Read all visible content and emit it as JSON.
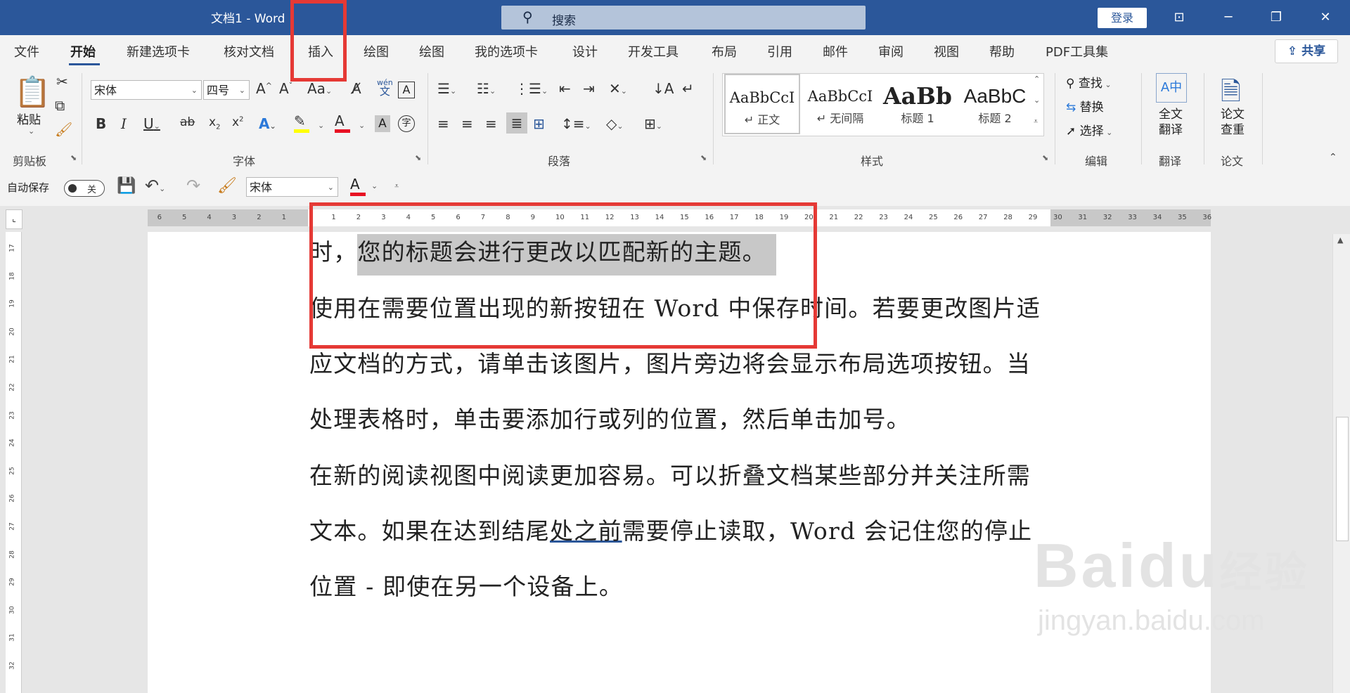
{
  "titlebar": {
    "title": "文档1  -  Word",
    "search_placeholder": "搜索",
    "login_label": "登录",
    "min_icon": "minimize-icon",
    "restore_icon": "restore-icon",
    "close_icon": "close-icon"
  },
  "tabs": [
    "文件",
    "开始",
    "新建选项卡",
    "核对文档",
    "插入",
    "绘图",
    "绘图",
    "我的选项卡",
    "设计",
    "开发工具",
    "布局",
    "引用",
    "邮件",
    "审阅",
    "视图",
    "帮助",
    "PDF工具集"
  ],
  "active_tab": "开始",
  "share_label": "共享",
  "ribbon": {
    "clipboard": {
      "paste_label": "粘贴",
      "group_label": "剪贴板"
    },
    "font": {
      "font_name": "宋体",
      "font_size": "四号",
      "group_label": "字体",
      "wen_label": "wén",
      "wen_char": "文"
    },
    "paragraph": {
      "group_label": "段落"
    },
    "styles": {
      "group_label": "样式",
      "items": [
        {
          "preview": "AaBbCcI",
          "label": "↵ 正文"
        },
        {
          "preview": "AaBbCcI",
          "label": "↵ 无间隔"
        },
        {
          "preview": "AaBb",
          "label": "标题 1"
        },
        {
          "preview": "AaBbC",
          "label": "标题 2"
        }
      ]
    },
    "editing": {
      "group_label": "编辑",
      "find": "查找",
      "replace": "替换",
      "select": "选择"
    },
    "translate": {
      "group_label": "翻译",
      "button": "全文翻译",
      "line1": "全文",
      "line2": "翻译"
    },
    "paper": {
      "group_label": "论文",
      "line1": "论文",
      "line2": "查重"
    }
  },
  "qat": {
    "autosave_label": "自动保存",
    "autosave_state": "关",
    "font_name": "宋体"
  },
  "ruler": {
    "left_numbers": [
      "6",
      "5",
      "4",
      "3",
      "2",
      "1"
    ],
    "right_numbers": [
      "1",
      "2",
      "3",
      "4",
      "5",
      "6",
      "7",
      "8",
      "9",
      "10",
      "11",
      "12",
      "13",
      "14",
      "15",
      "16",
      "17",
      "18",
      "19",
      "20",
      "21",
      "22",
      "23",
      "24",
      "25",
      "26",
      "27",
      "28",
      "29",
      "30",
      "31",
      "32",
      "33",
      "34",
      "35",
      "36"
    ],
    "vertical_numbers": [
      "17",
      "18",
      "19",
      "20",
      "21",
      "22",
      "23",
      "24",
      "25",
      "26",
      "27",
      "28",
      "29",
      "30",
      "31",
      "32"
    ]
  },
  "document": {
    "line1_pre": "时，",
    "line1_highlight": "您的标题会进行更改以匹配新的主题。",
    "line2": "使用在需要位置出现的新按钮在 Word 中保存时间。若要更改图片适",
    "line3": "应文档的方式，请单击该图片，图片旁边将会显示布局选项按钮。当",
    "line4": "处理表格时，单击要添加行或列的位置，然后单击加号。",
    "line5": "在新的阅读视图中阅读更加容易。可以折叠文档某些部分并关注所需",
    "line6_pre": "文本。如果在达到结尾",
    "line6_squiggle": "处之前",
    "line6_post": "需要停止读取，Word  会记住您的停止",
    "line7": "位置 - 即使在另一个设备上。"
  },
  "watermark": {
    "brand": "Baidu",
    "brand_cn": "经验",
    "url": "jingyan.baidu.com"
  },
  "colors": {
    "titlebar": "#2b579a",
    "annotation": "#e53935"
  }
}
